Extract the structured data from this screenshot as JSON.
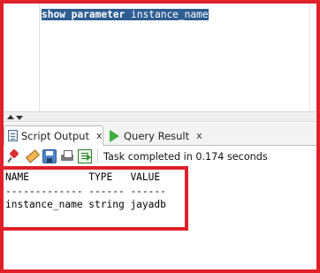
{
  "editor": {
    "code_keywords": "show parameter",
    "code_rest": " instance_name"
  },
  "tabs": [
    {
      "label": "Script Output",
      "close": "x",
      "icon": "script-output-icon"
    },
    {
      "label": "Query Result",
      "close": "x",
      "icon": "run-query-icon"
    }
  ],
  "toolbar": {
    "icons": [
      "pin-icon",
      "eraser-icon",
      "save-icon",
      "print-icon",
      "export-icon"
    ],
    "status": "Task completed in 0.174 seconds"
  },
  "output": {
    "header": "NAME          TYPE   VALUE",
    "divider": "------------- ------ ------",
    "row": "instance_name string jayadb"
  },
  "colors": {
    "annotation_red": "#e0202a",
    "selection": "#2e5d91",
    "run_green": "#3fae3f"
  }
}
